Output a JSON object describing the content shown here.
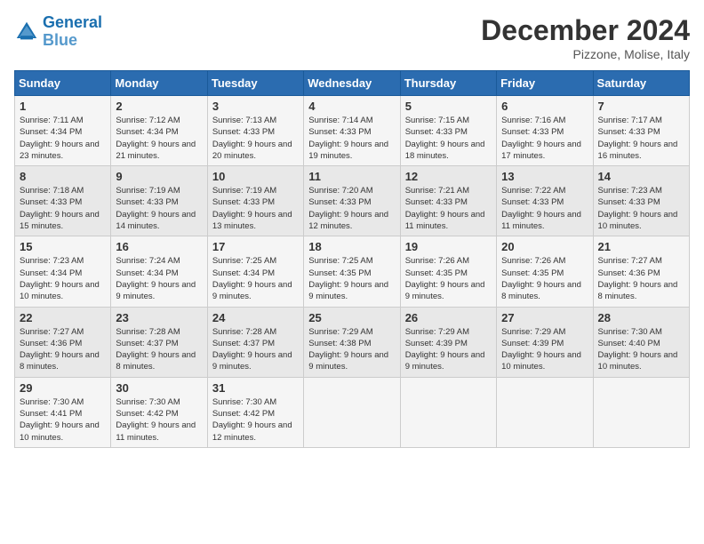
{
  "logo": {
    "line1": "General",
    "line2": "Blue"
  },
  "title": "December 2024",
  "subtitle": "Pizzone, Molise, Italy",
  "header_days": [
    "Sunday",
    "Monday",
    "Tuesday",
    "Wednesday",
    "Thursday",
    "Friday",
    "Saturday"
  ],
  "weeks": [
    [
      {
        "day": 1,
        "sunrise": "7:11 AM",
        "sunset": "4:34 PM",
        "daylight": "9 hours and 23 minutes."
      },
      {
        "day": 2,
        "sunrise": "7:12 AM",
        "sunset": "4:34 PM",
        "daylight": "9 hours and 21 minutes."
      },
      {
        "day": 3,
        "sunrise": "7:13 AM",
        "sunset": "4:33 PM",
        "daylight": "9 hours and 20 minutes."
      },
      {
        "day": 4,
        "sunrise": "7:14 AM",
        "sunset": "4:33 PM",
        "daylight": "9 hours and 19 minutes."
      },
      {
        "day": 5,
        "sunrise": "7:15 AM",
        "sunset": "4:33 PM",
        "daylight": "9 hours and 18 minutes."
      },
      {
        "day": 6,
        "sunrise": "7:16 AM",
        "sunset": "4:33 PM",
        "daylight": "9 hours and 17 minutes."
      },
      {
        "day": 7,
        "sunrise": "7:17 AM",
        "sunset": "4:33 PM",
        "daylight": "9 hours and 16 minutes."
      }
    ],
    [
      {
        "day": 8,
        "sunrise": "7:18 AM",
        "sunset": "4:33 PM",
        "daylight": "9 hours and 15 minutes."
      },
      {
        "day": 9,
        "sunrise": "7:19 AM",
        "sunset": "4:33 PM",
        "daylight": "9 hours and 14 minutes."
      },
      {
        "day": 10,
        "sunrise": "7:19 AM",
        "sunset": "4:33 PM",
        "daylight": "9 hours and 13 minutes."
      },
      {
        "day": 11,
        "sunrise": "7:20 AM",
        "sunset": "4:33 PM",
        "daylight": "9 hours and 12 minutes."
      },
      {
        "day": 12,
        "sunrise": "7:21 AM",
        "sunset": "4:33 PM",
        "daylight": "9 hours and 11 minutes."
      },
      {
        "day": 13,
        "sunrise": "7:22 AM",
        "sunset": "4:33 PM",
        "daylight": "9 hours and 11 minutes."
      },
      {
        "day": 14,
        "sunrise": "7:23 AM",
        "sunset": "4:33 PM",
        "daylight": "9 hours and 10 minutes."
      }
    ],
    [
      {
        "day": 15,
        "sunrise": "7:23 AM",
        "sunset": "4:34 PM",
        "daylight": "9 hours and 10 minutes."
      },
      {
        "day": 16,
        "sunrise": "7:24 AM",
        "sunset": "4:34 PM",
        "daylight": "9 hours and 9 minutes."
      },
      {
        "day": 17,
        "sunrise": "7:25 AM",
        "sunset": "4:34 PM",
        "daylight": "9 hours and 9 minutes."
      },
      {
        "day": 18,
        "sunrise": "7:25 AM",
        "sunset": "4:35 PM",
        "daylight": "9 hours and 9 minutes."
      },
      {
        "day": 19,
        "sunrise": "7:26 AM",
        "sunset": "4:35 PM",
        "daylight": "9 hours and 9 minutes."
      },
      {
        "day": 20,
        "sunrise": "7:26 AM",
        "sunset": "4:35 PM",
        "daylight": "9 hours and 8 minutes."
      },
      {
        "day": 21,
        "sunrise": "7:27 AM",
        "sunset": "4:36 PM",
        "daylight": "9 hours and 8 minutes."
      }
    ],
    [
      {
        "day": 22,
        "sunrise": "7:27 AM",
        "sunset": "4:36 PM",
        "daylight": "9 hours and 8 minutes."
      },
      {
        "day": 23,
        "sunrise": "7:28 AM",
        "sunset": "4:37 PM",
        "daylight": "9 hours and 8 minutes."
      },
      {
        "day": 24,
        "sunrise": "7:28 AM",
        "sunset": "4:37 PM",
        "daylight": "9 hours and 9 minutes."
      },
      {
        "day": 25,
        "sunrise": "7:29 AM",
        "sunset": "4:38 PM",
        "daylight": "9 hours and 9 minutes."
      },
      {
        "day": 26,
        "sunrise": "7:29 AM",
        "sunset": "4:39 PM",
        "daylight": "9 hours and 9 minutes."
      },
      {
        "day": 27,
        "sunrise": "7:29 AM",
        "sunset": "4:39 PM",
        "daylight": "9 hours and 10 minutes."
      },
      {
        "day": 28,
        "sunrise": "7:30 AM",
        "sunset": "4:40 PM",
        "daylight": "9 hours and 10 minutes."
      }
    ],
    [
      {
        "day": 29,
        "sunrise": "7:30 AM",
        "sunset": "4:41 PM",
        "daylight": "9 hours and 10 minutes."
      },
      {
        "day": 30,
        "sunrise": "7:30 AM",
        "sunset": "4:42 PM",
        "daylight": "9 hours and 11 minutes."
      },
      {
        "day": 31,
        "sunrise": "7:30 AM",
        "sunset": "4:42 PM",
        "daylight": "9 hours and 12 minutes."
      },
      null,
      null,
      null,
      null
    ]
  ],
  "labels": {
    "sunrise": "Sunrise:",
    "sunset": "Sunset:",
    "daylight": "Daylight:"
  }
}
